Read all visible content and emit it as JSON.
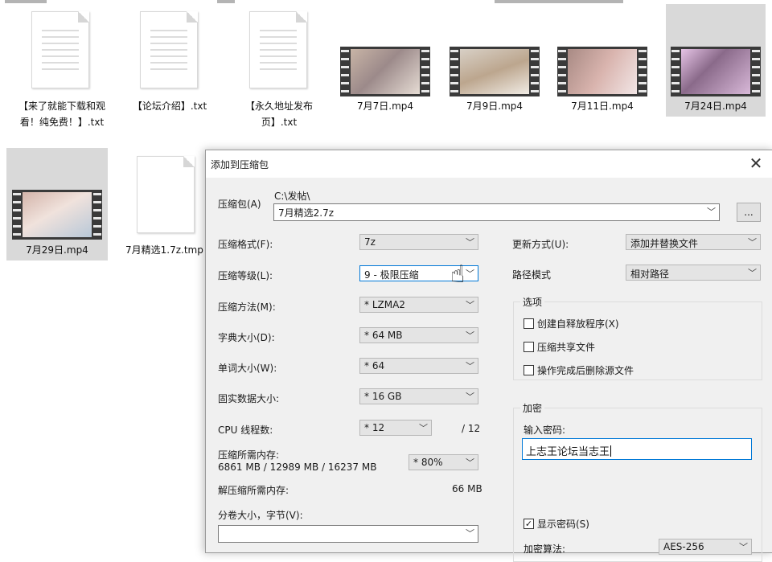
{
  "desktop": {
    "files": [
      {
        "name": "【来了就能下载和观看！纯免费！】.txt",
        "kind": "text"
      },
      {
        "name": "【论坛介绍】.txt",
        "kind": "text"
      },
      {
        "name": "【永久地址发布页】.txt",
        "kind": "text"
      },
      {
        "name": "7月7日.mp4",
        "kind": "video"
      },
      {
        "name": "7月9日.mp4",
        "kind": "video"
      },
      {
        "name": "7月11日.mp4",
        "kind": "video"
      },
      {
        "name": "7月24日.mp4",
        "kind": "video"
      },
      {
        "name": "7月29日.mp4",
        "kind": "video"
      },
      {
        "name": "7月精选1.7z.tmp",
        "kind": "temp"
      }
    ]
  },
  "dialog": {
    "title": "添加到压缩包",
    "close_icon": "close-icon",
    "archive_label": "压缩包(A)",
    "archive_path": "C:\\发帖\\",
    "archive_name": "7月精选2.7z",
    "browse_label": "...",
    "left": {
      "format_label": "压缩格式(F):",
      "format_value": "7z",
      "level_label": "压缩等级(L):",
      "level_value": "9 - 极限压缩",
      "method_label": "压缩方法(M):",
      "method_value": "* LZMA2",
      "dict_label": "字典大小(D):",
      "dict_value": "* 64 MB",
      "word_label": "单词大小(W):",
      "word_value": "* 64",
      "solid_label": "固实数据大小:",
      "solid_value": "* 16 GB",
      "cpu_label": "CPU 线程数:",
      "cpu_value": "* 12",
      "cpu_total": "/ 12",
      "mem_label": "压缩所需内存:",
      "mem_detail": "6861 MB / 12989 MB / 16237 MB",
      "mem_pct": "* 80%",
      "decomp_label": "解压缩所需内存:",
      "decomp_value": "66 MB",
      "split_label": "分卷大小，字节(V):",
      "split_value": ""
    },
    "right": {
      "update_label": "更新方式(U):",
      "update_value": "添加并替换文件",
      "path_label": "路径模式",
      "path_value": "相对路径",
      "options_title": "选项",
      "opt_sfx": "创建自释放程序(X)",
      "opt_shared": "压缩共享文件",
      "opt_delete": "操作完成后删除源文件",
      "enc_title": "加密",
      "pwd_label": "输入密码:",
      "pwd_value": "上志王论坛当志王",
      "show_pwd": "显示密码(S)",
      "enc_method_label": "加密算法:",
      "enc_method_value": "AES-256"
    }
  }
}
